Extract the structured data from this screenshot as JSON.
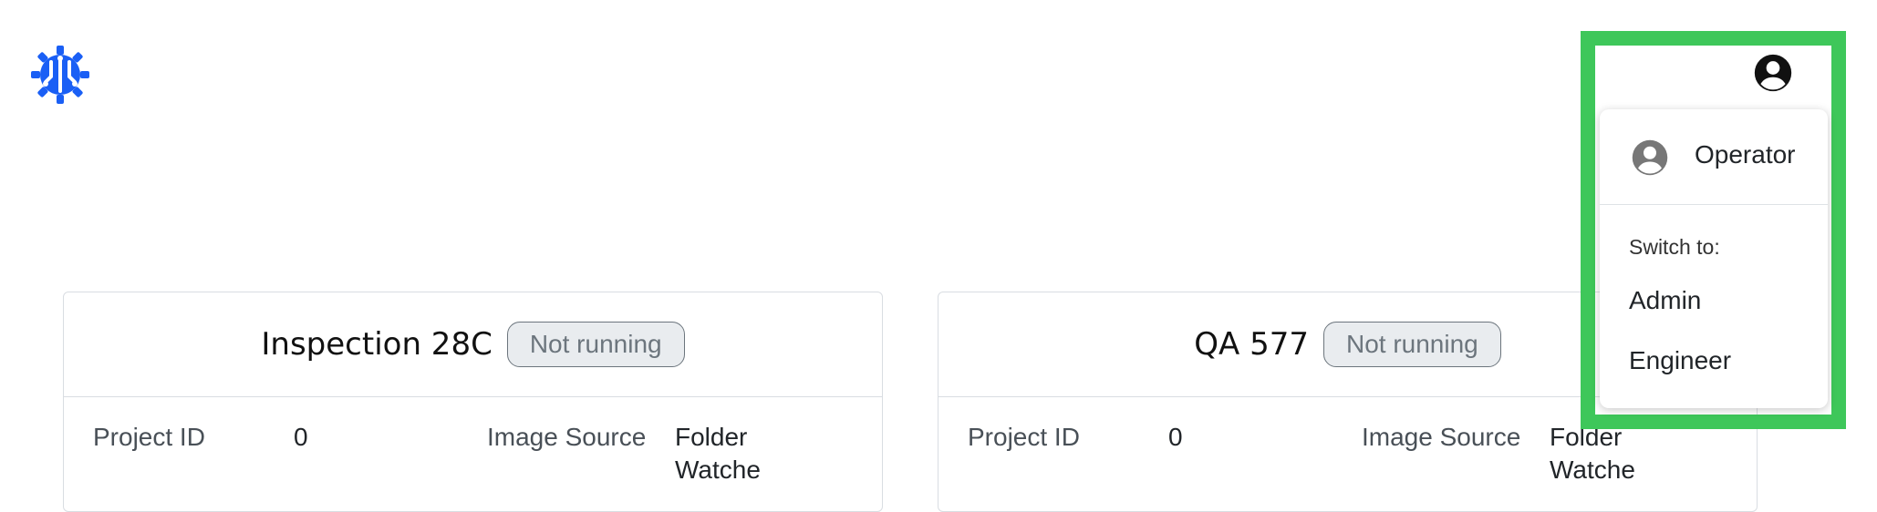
{
  "header": {
    "logo_icon": "gear-robot-logo",
    "brand_color": "#1a5ff5"
  },
  "cards": [
    {
      "title": "Inspection 28C",
      "status": "Not running",
      "fields": [
        {
          "label": "Project ID",
          "value": "0"
        },
        {
          "label": "Image Source",
          "value": "Folder Watche"
        }
      ]
    },
    {
      "title": "QA 577",
      "status": "Not running",
      "fields": [
        {
          "label": "Project ID",
          "value": "0"
        },
        {
          "label": "Image Source",
          "value": "Folder Watche"
        }
      ]
    }
  ],
  "user_menu": {
    "trigger_icon": "account-circle-icon",
    "current_role": "Operator",
    "switch_heading": "Switch to:",
    "options": [
      "Admin",
      "Engineer"
    ],
    "highlight_color": "#3ec75a"
  }
}
